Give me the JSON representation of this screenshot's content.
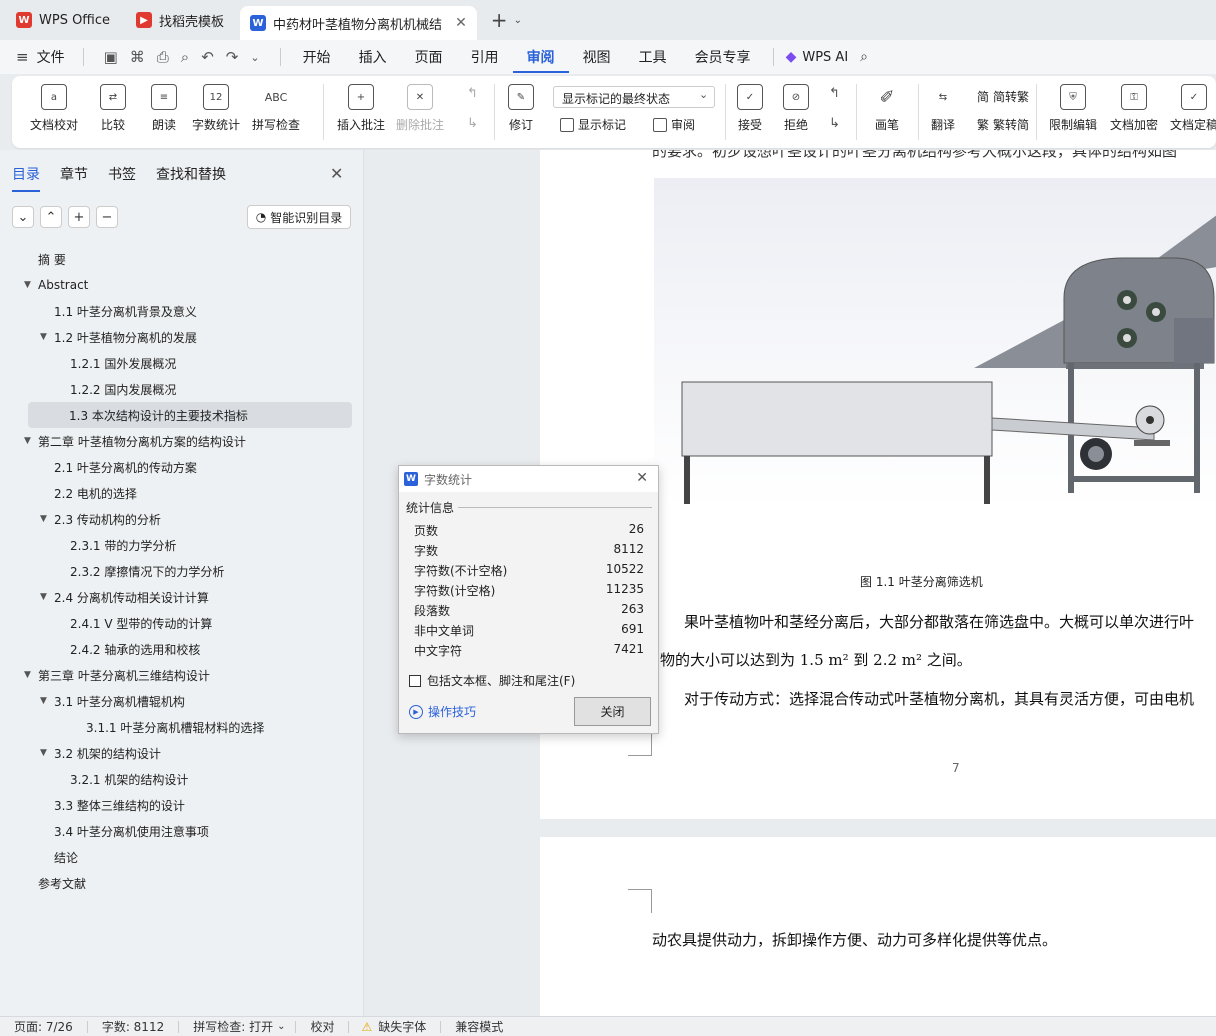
{
  "tabs": {
    "wps": "WPS Office",
    "template": "找稻壳模板",
    "doc": "中药材叶茎植物分离机机械结",
    "new_tab": "+"
  },
  "menu": {
    "file": "文件",
    "items": [
      "开始",
      "插入",
      "页面",
      "引用",
      "审阅",
      "视图",
      "工具",
      "会员专享"
    ],
    "active": "审阅",
    "wps_ai": "WPS AI"
  },
  "ribbon": {
    "proofread": "文档校对",
    "compare": "比较",
    "read_aloud": "朗读",
    "word_count": "字数统计",
    "word_count_icon": "12",
    "spell_check": "拼写检查",
    "spell_check_icon": "ABC",
    "insert_comment": "插入批注",
    "delete_comment": "删除批注",
    "track_changes": "修订",
    "markup_state": "显示标记的最终状态",
    "show_markup": "显示标记",
    "review": "审阅",
    "accept": "接受",
    "reject": "拒绝",
    "pen": "画笔",
    "translate": "翻译",
    "to_traditional": "简转繁",
    "to_simplified": "繁转简",
    "restrict_edit": "限制编辑",
    "encrypt": "文档加密",
    "finalize": "文档定稿"
  },
  "sidebar": {
    "tabs": [
      "目录",
      "章节",
      "书签",
      "查找和替换"
    ],
    "smart_toc": "智能识别目录",
    "toc": [
      {
        "label": "摘  要",
        "level": 1,
        "expand": ""
      },
      {
        "label": "Abstract",
        "level": 1,
        "expand": "▼"
      },
      {
        "label": "1.1 叶茎分离机背景及意义",
        "level": 2,
        "expand": ""
      },
      {
        "label": "1.2  叶茎植物分离机的发展",
        "level": 2,
        "expand": "▼"
      },
      {
        "label": "1.2.1 国外发展概况",
        "level": 3,
        "expand": ""
      },
      {
        "label": "1.2.2 国内发展概况",
        "level": 3,
        "expand": ""
      },
      {
        "label": "1.3  本次结构设计的主要技术指标",
        "level": 2,
        "expand": "",
        "selected": true
      },
      {
        "label": "第二章  叶茎植物分离机方案的结构设计",
        "level": 1,
        "expand": "▼"
      },
      {
        "label": "2.1  叶茎分离机的传动方案",
        "level": 2,
        "expand": ""
      },
      {
        "label": "2.2 电机的选择",
        "level": 2,
        "expand": ""
      },
      {
        "label": "2.3 传动机构的分析",
        "level": 2,
        "expand": "▼"
      },
      {
        "label": "2.3.1 带的力学分析",
        "level": 3,
        "expand": ""
      },
      {
        "label": "2.3.2 摩擦情况下的力学分析",
        "level": 3,
        "expand": ""
      },
      {
        "label": "2.4  分离机传动相关设计计算",
        "level": 2,
        "expand": "▼"
      },
      {
        "label": "2.4.1 V 型带的传动的计算",
        "level": 3,
        "expand": ""
      },
      {
        "label": "2.4.2  轴承的选用和校核",
        "level": 3,
        "expand": ""
      },
      {
        "label": "第三章   叶茎分离机三维结构设计",
        "level": 1,
        "expand": "▼"
      },
      {
        "label": "3.1 叶茎分离机槽辊机构",
        "level": 2,
        "expand": "▼"
      },
      {
        "label": "3.1.1 叶茎分离机槽辊材料的选择",
        "level": 4,
        "expand": ""
      },
      {
        "label": "3.2  机架的结构设计",
        "level": 2,
        "expand": "▼"
      },
      {
        "label": "3.2.1 机架的结构设计",
        "level": 3,
        "expand": ""
      },
      {
        "label": "3.3 整体三维结构的设计",
        "level": 2,
        "expand": ""
      },
      {
        "label": "3.4 叶茎分离机使用注意事项",
        "level": 2,
        "expand": ""
      },
      {
        "label": "结论",
        "level": 2,
        "expand": ""
      },
      {
        "label": "参考文献",
        "level": 1,
        "expand": ""
      }
    ]
  },
  "document": {
    "top_line": "的要求。初步设想叶茎设计的叶茎分离机结构参考大概尔这段，具体的结构如图",
    "figure_caption": "图 1.1  叶茎分离筛选机",
    "p1": "果叶茎植物叶和茎经分离后，大部分都散落在筛选盘中。大概可以单次进行叶",
    "p2": "物的大小可以达到为   1.5 m² 到   2.2 m² 之间。",
    "p3": "对于传动方式：选择混合传动式叶茎植物分离机，其具有灵活方便，可由电机",
    "page_number": "7",
    "p4": "动农具提供动力，拆卸操作方便、动力可多样化提供等优点。"
  },
  "dialog": {
    "title": "字数统计",
    "section": "统计信息",
    "rows": [
      {
        "label": "页数",
        "value": "26"
      },
      {
        "label": "字数",
        "value": "8112"
      },
      {
        "label": "字符数(不计空格)",
        "value": "10522"
      },
      {
        "label": "字符数(计空格)",
        "value": "11235"
      },
      {
        "label": "段落数",
        "value": "263"
      },
      {
        "label": "非中文单词",
        "value": "691"
      },
      {
        "label": "中文字符",
        "value": "7421"
      }
    ],
    "checkbox": "包括文本框、脚注和尾注(F)",
    "tips": "操作技巧",
    "close": "关闭"
  },
  "status": {
    "page": "页面: 7/26",
    "words": "字数: 8112",
    "spell": "拼写检查: 打开",
    "proof": "校对",
    "missing_font": "缺失字体",
    "compat": "兼容模式"
  },
  "colors": {
    "accent": "#2b62d9",
    "wps_red": "#e0392f"
  }
}
